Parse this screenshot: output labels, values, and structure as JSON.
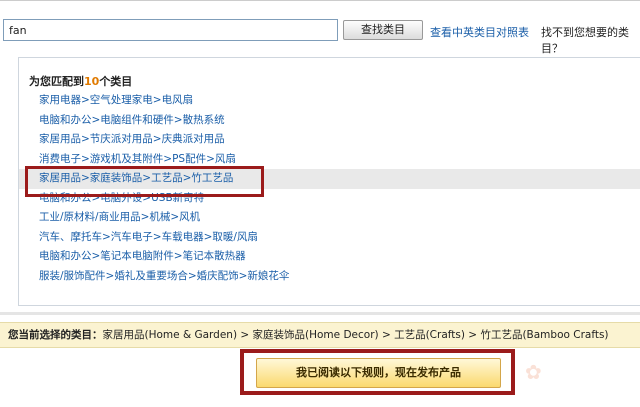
{
  "search": {
    "value": "fan",
    "button_label": "查找类目",
    "compare_link": "查看中英类目对照表",
    "not_found_text": "找不到您想要的类目？"
  },
  "results": {
    "header_prefix": "为您匹配到",
    "count": "10",
    "header_suffix": "个类目",
    "items": [
      {
        "label": "家用电器>空气处理家电>电风扇"
      },
      {
        "label": "电脑和办公>电脑组件和硬件>散热系统"
      },
      {
        "label": "家居用品>节庆派对用品>庆典派对用品"
      },
      {
        "label": "消费电子>游戏机及其附件>PS配件>风扇"
      },
      {
        "label": "家居用品>家庭装饰品>工艺品>竹工艺品"
      },
      {
        "label": "电脑和办公>电脑外设>USB新奇特"
      },
      {
        "label": "工业/原材料/商业用品>机械>风机"
      },
      {
        "label": "汽车、摩托车>汽车电子>车载电器>取暖/风扇"
      },
      {
        "label": "电脑和办公>笔记本电脑附件>笔记本散热器"
      },
      {
        "label": "服装/服饰配件>婚礼及重要场合>婚庆配饰>新娘花伞"
      }
    ],
    "selected_index": 4
  },
  "selection": {
    "label": "您当前选择的类目：",
    "path": "家居用品(Home & Garden) > 家庭装饰品(Home Decor) > 工艺品(Crafts) > 竹工艺品(Bamboo Crafts)"
  },
  "publish": {
    "button_label": "我已阅读以下规则，现在发布产品"
  },
  "colors": {
    "link": "#1a5ea8",
    "highlight_border": "#9b1b1b",
    "count_accent": "#e07a00",
    "selection_bg": "#fbf3d1"
  }
}
